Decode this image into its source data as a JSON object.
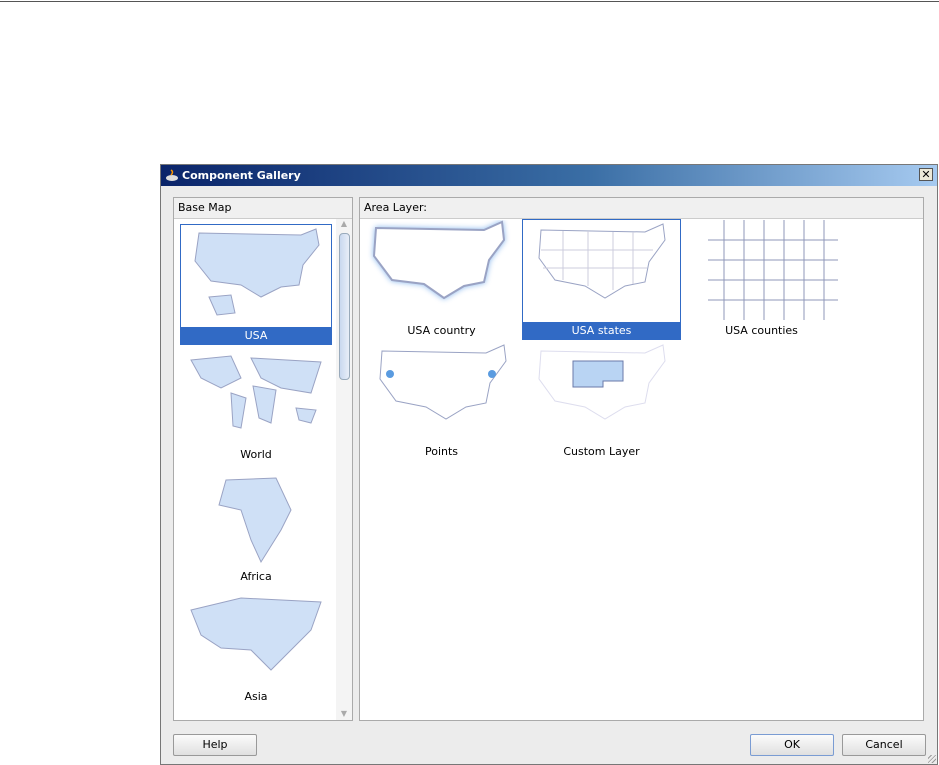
{
  "dialog": {
    "title": "Component Gallery",
    "close_label": "✕"
  },
  "base_map": {
    "header": "Base Map",
    "items": [
      {
        "label": "USA",
        "selected": true
      },
      {
        "label": "World"
      },
      {
        "label": "Africa"
      },
      {
        "label": "Asia"
      }
    ]
  },
  "area_layer": {
    "header": "Area Layer:",
    "items": [
      {
        "label": "USA country"
      },
      {
        "label": "USA states",
        "selected": true
      },
      {
        "label": "USA counties"
      },
      {
        "label": "Points"
      },
      {
        "label": "Custom Layer"
      }
    ]
  },
  "buttons": {
    "help": "Help",
    "ok": "OK",
    "cancel": "Cancel"
  },
  "colors": {
    "selection": "#316ac5",
    "map_fill": "#b9d4f3",
    "map_stroke": "#9aa3c4"
  }
}
